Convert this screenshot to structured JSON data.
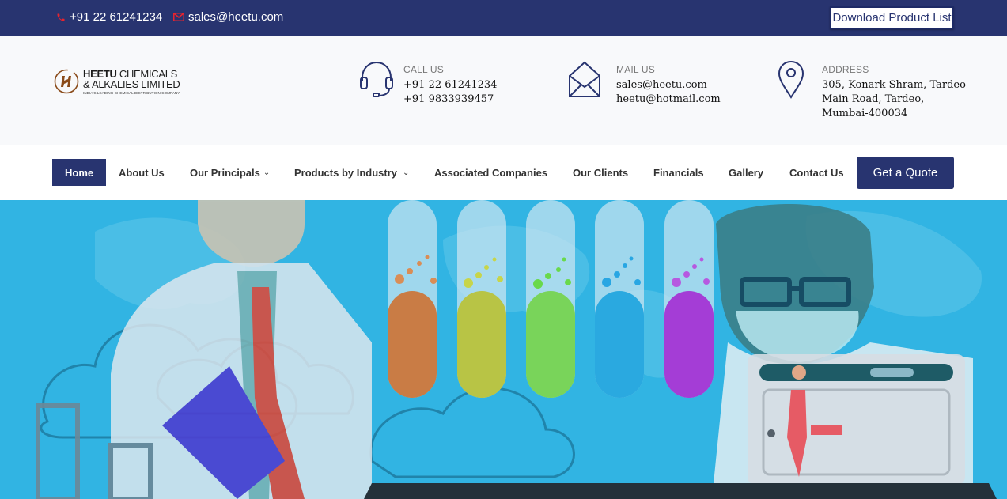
{
  "topbar": {
    "phone": "+91 22 61241234",
    "email": "sales@heetu.com",
    "download_button": "Download Product List"
  },
  "logo": {
    "line1_bold": "HEETU",
    "line1_rest": " CHEMICALS",
    "line2": "& ALKALIES LIMITED",
    "tagline": "INDIA'S LEADING CHEMICAL DISTRIBUTION COMPANY"
  },
  "contact": {
    "call": {
      "label": "CALL US",
      "line1": "+91 22 61241234",
      "line2": "+91 9833939457"
    },
    "mail": {
      "label": "MAIL US",
      "line1": "sales@heetu.com",
      "line2": "heetu@hotmail.com"
    },
    "address": {
      "label": "ADDRESS",
      "line1": "305, Konark Shram, Tardeo",
      "line2": "Main Road, Tardeo,",
      "line3": "Mumbai-400034"
    }
  },
  "nav": {
    "items": [
      "Home",
      "About Us",
      "Our Principals",
      "Products by Industry",
      "Associated Companies",
      "Our Clients",
      "Financials",
      "Gallery",
      "Contact Us"
    ],
    "active": "Home",
    "quote_button": "Get a Quote"
  },
  "colors": {
    "brand": "#283470",
    "hero_bg": "#31b4e3",
    "icon_red": "#e8232e"
  },
  "icons": {
    "phone": "phone-icon",
    "email": "envelope-icon",
    "headset": "headset-icon",
    "mail": "mail-open-icon",
    "address": "map-pin-icon",
    "dropdown": "chevron-down-icon"
  }
}
